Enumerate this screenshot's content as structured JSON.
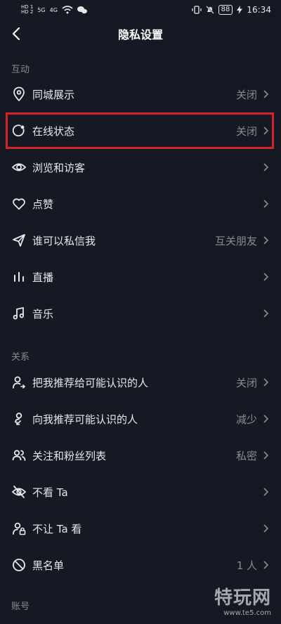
{
  "status_bar": {
    "sim1": "HD 1",
    "sim2": "HD 2",
    "net1": "5G",
    "net2": "4G",
    "battery": "88",
    "time": "16:34"
  },
  "header": {
    "title": "隐私设置"
  },
  "sections": {
    "interaction": "互动",
    "relations": "关系",
    "account": "账号"
  },
  "rows": [
    {
      "label": "同城展示",
      "value": "关闭",
      "icon": "location-icon"
    },
    {
      "label": "在线状态",
      "value": "关闭",
      "icon": "online-status-icon"
    },
    {
      "label": "浏览和访客",
      "value": "",
      "icon": "eye-icon"
    },
    {
      "label": "点赞",
      "value": "",
      "icon": "heart-icon"
    },
    {
      "label": "谁可以私信我",
      "value": "互关朋友",
      "icon": "send-icon"
    },
    {
      "label": "直播",
      "value": "",
      "icon": "live-bars-icon"
    },
    {
      "label": "音乐",
      "value": "",
      "icon": "music-icon"
    },
    {
      "label": "把我推荐给可能认识的人",
      "value": "关闭",
      "icon": "user-share-icon"
    },
    {
      "label": "向我推荐可能认识的人",
      "value": "减少",
      "icon": "user-recommend-icon"
    },
    {
      "label": "关注和粉丝列表",
      "value": "私密",
      "icon": "users-icon"
    },
    {
      "label": "不看 Ta",
      "value": "",
      "icon": "eye-off-icon"
    },
    {
      "label": "不让 Ta 看",
      "value": "",
      "icon": "user-lock-icon"
    },
    {
      "label": "黑名单",
      "value": "1 人",
      "icon": "block-icon"
    }
  ],
  "watermark": {
    "main": "特玩网",
    "url": "www.te5.com"
  },
  "colors": {
    "background": "#161823",
    "highlight": "#d4232b",
    "muted": "#8a8b91"
  }
}
